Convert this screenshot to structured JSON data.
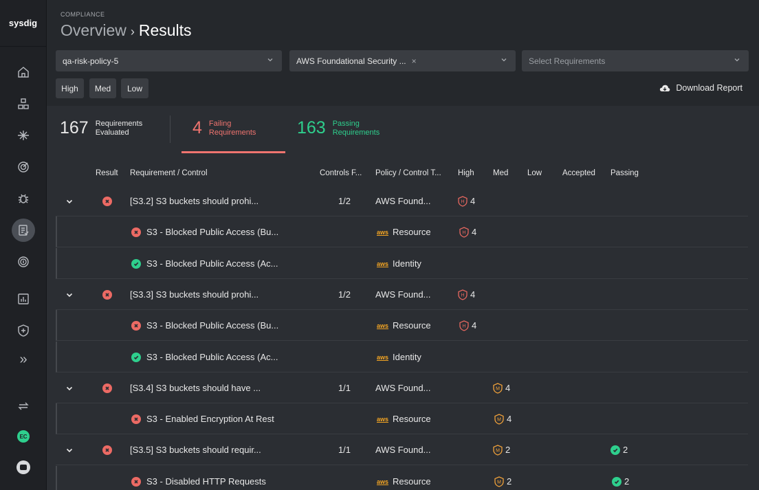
{
  "brand": "sysdig",
  "header": {
    "section": "COMPLIANCE",
    "breadcrumb_parent": "Overview",
    "breadcrumb_separator": "›",
    "page_title": "Results"
  },
  "sidebar": {
    "icons": [
      "home-icon",
      "inventory-icon",
      "integrations-icon",
      "posture-radar-icon",
      "bug-icon",
      "compliance-icon",
      "fingerprint-icon",
      "reports-icon",
      "shield-plus-icon",
      "expand-icon",
      "sync-icon"
    ],
    "expand_glyph": "»",
    "avatar_initials": "EC"
  },
  "filters": {
    "zone": "qa-risk-policy-5",
    "policy": "AWS Foundational Security ...",
    "policy_clear": "×",
    "requirements_placeholder": "Select Requirements",
    "severity_buttons": [
      "High",
      "Med",
      "Low"
    ],
    "download_label": "Download Report"
  },
  "stats": {
    "evaluated": {
      "value": "167",
      "label_line1": "Requirements",
      "label_line2": "Evaluated"
    },
    "failing": {
      "value": "4",
      "label_line1": "Failing",
      "label_line2": "Requirements"
    },
    "passing": {
      "value": "163",
      "label_line1": "Passing",
      "label_line2": "Requirements"
    }
  },
  "table": {
    "columns": [
      "Result",
      "Requirement / Control",
      "Controls F...",
      "Policy / Control T...",
      "High",
      "Med",
      "Low",
      "Accepted",
      "Passing"
    ],
    "rows": [
      {
        "kind": "parent",
        "result": "fail",
        "name": "[S3.2] S3 buckets should prohi...",
        "controls": "1/2",
        "policy": "AWS Found...",
        "high": "4",
        "med": "",
        "passing": ""
      },
      {
        "kind": "child",
        "result": "fail",
        "name": "S3 - Blocked Public Access (Bu...",
        "controls": "",
        "policy": "Resource",
        "high": "4",
        "med": "",
        "passing": ""
      },
      {
        "kind": "child",
        "result": "pass",
        "name": "S3 - Blocked Public Access (Ac...",
        "controls": "",
        "policy": "Identity",
        "high": "",
        "med": "",
        "passing": ""
      },
      {
        "kind": "parent",
        "result": "fail",
        "name": "[S3.3] S3 buckets should prohi...",
        "controls": "1/2",
        "policy": "AWS Found...",
        "high": "4",
        "med": "",
        "passing": ""
      },
      {
        "kind": "child",
        "result": "fail",
        "name": "S3 - Blocked Public Access (Bu...",
        "controls": "",
        "policy": "Resource",
        "high": "4",
        "med": "",
        "passing": ""
      },
      {
        "kind": "child",
        "result": "pass",
        "name": "S3 - Blocked Public Access (Ac...",
        "controls": "",
        "policy": "Identity",
        "high": "",
        "med": "",
        "passing": ""
      },
      {
        "kind": "parent",
        "result": "fail",
        "name": "[S3.4] S3 buckets should have ...",
        "controls": "1/1",
        "policy": "AWS Found...",
        "high": "",
        "med": "4",
        "passing": ""
      },
      {
        "kind": "child",
        "result": "fail",
        "name": "S3 - Enabled Encryption At Rest",
        "controls": "",
        "policy": "Resource",
        "high": "",
        "med": "4",
        "passing": ""
      },
      {
        "kind": "parent",
        "result": "fail",
        "name": "[S3.5] S3 buckets should requir...",
        "controls": "1/1",
        "policy": "AWS Found...",
        "high": "",
        "med": "2",
        "passing": "2"
      },
      {
        "kind": "child",
        "result": "fail",
        "name": "S3 - Disabled HTTP Requests",
        "controls": "",
        "policy": "Resource",
        "high": "",
        "med": "2",
        "passing": "2"
      }
    ],
    "aws_mark": "aws",
    "severity_letters": {
      "high": "H",
      "med": "M"
    }
  },
  "colors": {
    "fail": "#ec6a64",
    "pass": "#2ecf8d",
    "high": "#e5675f",
    "med": "#f0a13a",
    "aws": "#f5a623"
  }
}
